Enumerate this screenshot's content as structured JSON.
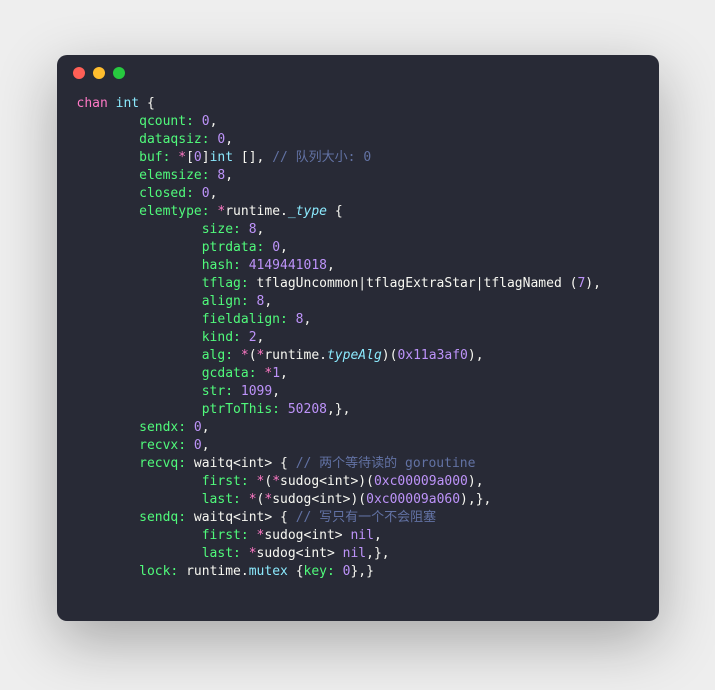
{
  "lines": {
    "l1": {
      "a": "chan",
      "b": "int",
      "c": "{"
    },
    "l2": {
      "a": "qcount:",
      "b": "0",
      "c": ","
    },
    "l3": {
      "a": "dataqsiz:",
      "b": "0",
      "c": ","
    },
    "l4": {
      "a": "buf:",
      "b": "*",
      "c": "[",
      "d": "0",
      "e": "]",
      "f": "int",
      "g": "[],",
      "h": "// 队列大小: 0"
    },
    "l5": {
      "a": "elemsize:",
      "b": "8",
      "c": ","
    },
    "l6": {
      "a": "closed:",
      "b": "0",
      "c": ","
    },
    "l7": {
      "a": "elemtype:",
      "b": "*",
      "c": "runtime",
      "d": ".",
      "e": "_type",
      "f": " {"
    },
    "l8": {
      "a": "size:",
      "b": "8",
      "c": ","
    },
    "l9": {
      "a": "ptrdata:",
      "b": "0",
      "c": ","
    },
    "l10": {
      "a": "hash:",
      "b": "4149441018",
      "c": ","
    },
    "l11": {
      "a": "tflag:",
      "b": "tflagUncommon|tflagExtraStar|tflagNamed",
      "c": "(",
      "d": "7",
      "e": "),"
    },
    "l12": {
      "a": "align:",
      "b": "8",
      "c": ","
    },
    "l13": {
      "a": "fieldalign:",
      "b": "8",
      "c": ","
    },
    "l14": {
      "a": "kind:",
      "b": "2",
      "c": ","
    },
    "l15": {
      "a": "alg:",
      "b": "*",
      "c": "(",
      "d": "*",
      "e": "runtime",
      "f": ".",
      "g": "typeAlg",
      "h": ")(",
      "i": "0x11a3af0",
      "j": "),"
    },
    "l16": {
      "a": "gcdata:",
      "b": "*",
      "c": "1",
      "d": ","
    },
    "l17": {
      "a": "str:",
      "b": "1099",
      "c": ","
    },
    "l18": {
      "a": "ptrToThis:",
      "b": "50208",
      "c": ",},"
    },
    "l19": {
      "a": "sendx:",
      "b": "0",
      "c": ","
    },
    "l20": {
      "a": "recvx:",
      "b": "0",
      "c": ","
    },
    "l21": {
      "a": "recvq:",
      "b": "waitq<int>",
      "c": "{",
      "d": "// 两个等待读的 goroutine"
    },
    "l22": {
      "a": "first:",
      "b": "*",
      "c": "(",
      "d": "*",
      "e": "sudog<int>",
      "f": ")(",
      "g": "0xc00009a000",
      "h": "),"
    },
    "l23": {
      "a": "last:",
      "b": "*",
      "c": "(",
      "d": "*",
      "e": "sudog<int>",
      "f": ")(",
      "g": "0xc00009a060",
      "h": "),},"
    },
    "l24": {
      "a": "sendq:",
      "b": "waitq<int>",
      "c": "{",
      "d": "// 写只有一个不会阻塞"
    },
    "l25": {
      "a": "first:",
      "b": "*",
      "c": "sudog<int>",
      "d": "nil",
      "e": ","
    },
    "l26": {
      "a": "last:",
      "b": "*",
      "c": "sudog<int>",
      "d": "nil",
      "e": ",},"
    },
    "l27": {
      "a": "lock:",
      "b": "runtime",
      "c": ".",
      "d": "mutex",
      "e": "{",
      "f": "key:",
      "g": "0",
      "h": "},}"
    }
  }
}
